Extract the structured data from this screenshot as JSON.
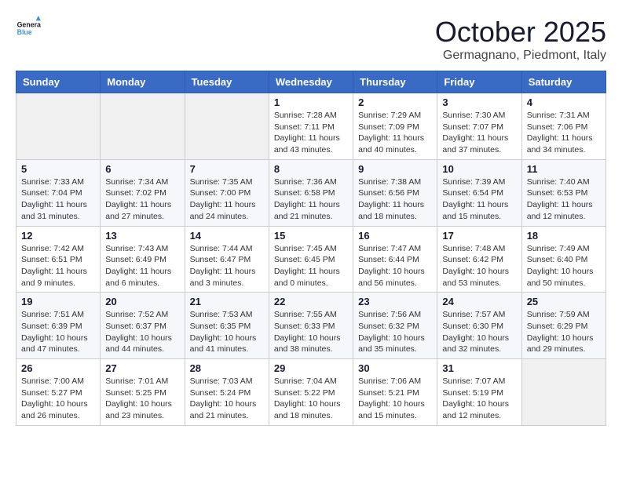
{
  "header": {
    "logo_general": "General",
    "logo_blue": "Blue",
    "month_title": "October 2025",
    "location": "Germagnano, Piedmont, Italy"
  },
  "weekdays": [
    "Sunday",
    "Monday",
    "Tuesday",
    "Wednesday",
    "Thursday",
    "Friday",
    "Saturday"
  ],
  "weeks": [
    [
      {
        "day": "",
        "info": ""
      },
      {
        "day": "",
        "info": ""
      },
      {
        "day": "",
        "info": ""
      },
      {
        "day": "1",
        "info": "Sunrise: 7:28 AM\nSunset: 7:11 PM\nDaylight: 11 hours\nand 43 minutes."
      },
      {
        "day": "2",
        "info": "Sunrise: 7:29 AM\nSunset: 7:09 PM\nDaylight: 11 hours\nand 40 minutes."
      },
      {
        "day": "3",
        "info": "Sunrise: 7:30 AM\nSunset: 7:07 PM\nDaylight: 11 hours\nand 37 minutes."
      },
      {
        "day": "4",
        "info": "Sunrise: 7:31 AM\nSunset: 7:06 PM\nDaylight: 11 hours\nand 34 minutes."
      }
    ],
    [
      {
        "day": "5",
        "info": "Sunrise: 7:33 AM\nSunset: 7:04 PM\nDaylight: 11 hours\nand 31 minutes."
      },
      {
        "day": "6",
        "info": "Sunrise: 7:34 AM\nSunset: 7:02 PM\nDaylight: 11 hours\nand 27 minutes."
      },
      {
        "day": "7",
        "info": "Sunrise: 7:35 AM\nSunset: 7:00 PM\nDaylight: 11 hours\nand 24 minutes."
      },
      {
        "day": "8",
        "info": "Sunrise: 7:36 AM\nSunset: 6:58 PM\nDaylight: 11 hours\nand 21 minutes."
      },
      {
        "day": "9",
        "info": "Sunrise: 7:38 AM\nSunset: 6:56 PM\nDaylight: 11 hours\nand 18 minutes."
      },
      {
        "day": "10",
        "info": "Sunrise: 7:39 AM\nSunset: 6:54 PM\nDaylight: 11 hours\nand 15 minutes."
      },
      {
        "day": "11",
        "info": "Sunrise: 7:40 AM\nSunset: 6:53 PM\nDaylight: 11 hours\nand 12 minutes."
      }
    ],
    [
      {
        "day": "12",
        "info": "Sunrise: 7:42 AM\nSunset: 6:51 PM\nDaylight: 11 hours\nand 9 minutes."
      },
      {
        "day": "13",
        "info": "Sunrise: 7:43 AM\nSunset: 6:49 PM\nDaylight: 11 hours\nand 6 minutes."
      },
      {
        "day": "14",
        "info": "Sunrise: 7:44 AM\nSunset: 6:47 PM\nDaylight: 11 hours\nand 3 minutes."
      },
      {
        "day": "15",
        "info": "Sunrise: 7:45 AM\nSunset: 6:45 PM\nDaylight: 11 hours\nand 0 minutes."
      },
      {
        "day": "16",
        "info": "Sunrise: 7:47 AM\nSunset: 6:44 PM\nDaylight: 10 hours\nand 56 minutes."
      },
      {
        "day": "17",
        "info": "Sunrise: 7:48 AM\nSunset: 6:42 PM\nDaylight: 10 hours\nand 53 minutes."
      },
      {
        "day": "18",
        "info": "Sunrise: 7:49 AM\nSunset: 6:40 PM\nDaylight: 10 hours\nand 50 minutes."
      }
    ],
    [
      {
        "day": "19",
        "info": "Sunrise: 7:51 AM\nSunset: 6:39 PM\nDaylight: 10 hours\nand 47 minutes."
      },
      {
        "day": "20",
        "info": "Sunrise: 7:52 AM\nSunset: 6:37 PM\nDaylight: 10 hours\nand 44 minutes."
      },
      {
        "day": "21",
        "info": "Sunrise: 7:53 AM\nSunset: 6:35 PM\nDaylight: 10 hours\nand 41 minutes."
      },
      {
        "day": "22",
        "info": "Sunrise: 7:55 AM\nSunset: 6:33 PM\nDaylight: 10 hours\nand 38 minutes."
      },
      {
        "day": "23",
        "info": "Sunrise: 7:56 AM\nSunset: 6:32 PM\nDaylight: 10 hours\nand 35 minutes."
      },
      {
        "day": "24",
        "info": "Sunrise: 7:57 AM\nSunset: 6:30 PM\nDaylight: 10 hours\nand 32 minutes."
      },
      {
        "day": "25",
        "info": "Sunrise: 7:59 AM\nSunset: 6:29 PM\nDaylight: 10 hours\nand 29 minutes."
      }
    ],
    [
      {
        "day": "26",
        "info": "Sunrise: 7:00 AM\nSunset: 5:27 PM\nDaylight: 10 hours\nand 26 minutes."
      },
      {
        "day": "27",
        "info": "Sunrise: 7:01 AM\nSunset: 5:25 PM\nDaylight: 10 hours\nand 23 minutes."
      },
      {
        "day": "28",
        "info": "Sunrise: 7:03 AM\nSunset: 5:24 PM\nDaylight: 10 hours\nand 21 minutes."
      },
      {
        "day": "29",
        "info": "Sunrise: 7:04 AM\nSunset: 5:22 PM\nDaylight: 10 hours\nand 18 minutes."
      },
      {
        "day": "30",
        "info": "Sunrise: 7:06 AM\nSunset: 5:21 PM\nDaylight: 10 hours\nand 15 minutes."
      },
      {
        "day": "31",
        "info": "Sunrise: 7:07 AM\nSunset: 5:19 PM\nDaylight: 10 hours\nand 12 minutes."
      },
      {
        "day": "",
        "info": ""
      }
    ]
  ]
}
